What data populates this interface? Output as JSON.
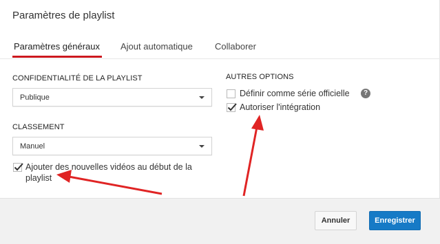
{
  "dialog": {
    "title": "Paramètres de playlist"
  },
  "tabs": [
    {
      "label": "Paramètres généraux"
    },
    {
      "label": "Ajout automatique"
    },
    {
      "label": "Collaborer"
    }
  ],
  "privacy": {
    "label": "CONFIDENTIALITÉ DE LA PLAYLIST",
    "value": "Publique"
  },
  "ordering": {
    "label": "CLASSEMENT",
    "value": "Manuel"
  },
  "add_to_top": {
    "label_line1": "Ajouter des nouvelles vidéos au début de la",
    "label_line2": "playlist",
    "checked": true
  },
  "other_options": {
    "label": "AUTRES OPTIONS",
    "official_series": {
      "label": "Définir comme série officielle",
      "checked": false
    },
    "allow_embedding": {
      "label": "Autoriser l'intégration",
      "checked": true
    },
    "help_glyph": "?"
  },
  "footer": {
    "cancel_label": "Annuler",
    "save_label": "Enregistrer"
  },
  "colors": {
    "accent_red": "#cc181e",
    "primary_blue": "#167ac6",
    "annotation_red": "#e02424"
  },
  "icons": [
    "checkmark-icon",
    "chevron-down-icon",
    "help-icon",
    "annotation-arrow"
  ]
}
